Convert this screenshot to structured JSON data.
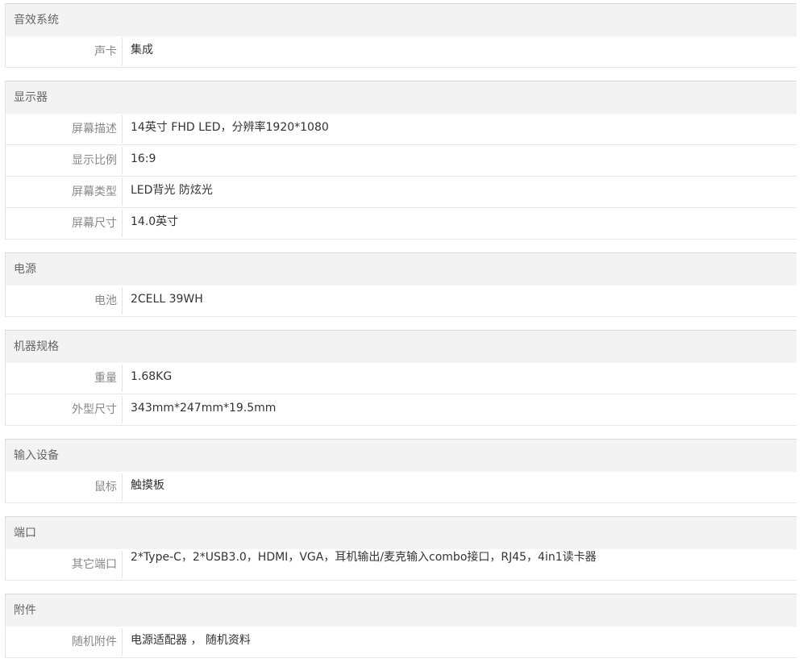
{
  "sections": [
    {
      "title": "音效系统",
      "rows": [
        {
          "label": "声卡",
          "value": "集成"
        }
      ]
    },
    {
      "title": "显示器",
      "rows": [
        {
          "label": "屏幕描述",
          "value": "14英寸 FHD LED，分辨率1920*1080"
        },
        {
          "label": "显示比例",
          "value": "16:9"
        },
        {
          "label": "屏幕类型",
          "value": "LED背光 防炫光"
        },
        {
          "label": "屏幕尺寸",
          "value": "14.0英寸"
        }
      ]
    },
    {
      "title": "电源",
      "rows": [
        {
          "label": "电池",
          "value": "2CELL 39WH"
        }
      ]
    },
    {
      "title": "机器规格",
      "rows": [
        {
          "label": "重量",
          "value": "1.68KG"
        },
        {
          "label": "外型尺寸",
          "value": "343mm*247mm*19.5mm"
        }
      ]
    },
    {
      "title": "输入设备",
      "rows": [
        {
          "label": "鼠标",
          "value": "触摸板"
        }
      ]
    },
    {
      "title": "端口",
      "rows": [
        {
          "label": "其它端口",
          "value": "2*Type-C，2*USB3.0，HDMI，VGA，耳机输出/麦克输入combo接口，RJ45，4in1读卡器"
        }
      ]
    },
    {
      "title": "附件",
      "rows": [
        {
          "label": "随机附件",
          "value": "电源适配器 ， 随机资料"
        }
      ]
    }
  ]
}
